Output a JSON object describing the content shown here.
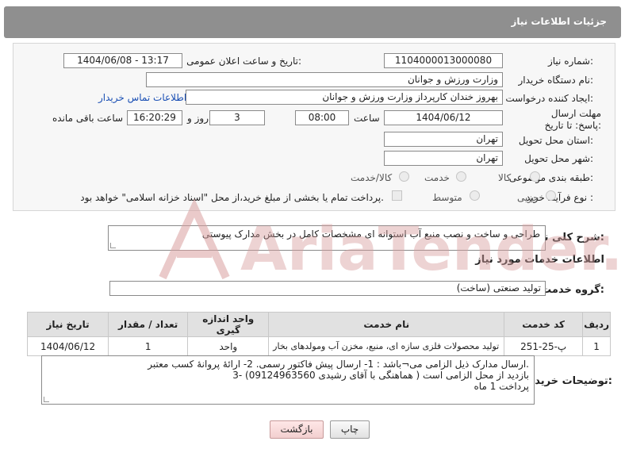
{
  "header": {
    "title": "جزئیات اطلاعات نیاز"
  },
  "form": {
    "need_number_label": "شماره نیاز:",
    "need_number": "1104000013000080",
    "announce_label": "تاریخ و ساعت اعلان عمومی:",
    "announce_value": "1404/06/08 - 13:17",
    "buyer_org_label": "نام دستگاه خریدار:",
    "buyer_org": "وزارت ورزش و جوانان",
    "creator_label": "ایجاد کننده درخواست:",
    "creator": "بهروز  خندان  کارپرداز وزارت ورزش و جوانان",
    "contact_link": "اطلاعات تماس خریدار",
    "deadline_label": "مهلت ارسال پاسخ: تا تاریخ:",
    "deadline_date": "1404/06/12",
    "time_label": "ساعت",
    "deadline_time": "08:00",
    "days_value": "3",
    "days_label": "روز و",
    "remaining_time": "16:20:29",
    "remaining_label": "ساعت باقی مانده",
    "province_label": "استان محل تحویل:",
    "province": "تهران",
    "city_label": "شهر محل تحویل:",
    "city": "تهران",
    "category_label": "طبقه بندی موضوعی:",
    "category_options": [
      "کالا",
      "خدمت",
      "کالا/خدمت"
    ],
    "process_label": "نوع فرآیند خرید :",
    "process_options": [
      "جزیی",
      "متوسط"
    ],
    "payment_note": "پرداخت تمام یا بخشی از مبلغ خرید،از محل \"اسناد خزانه اسلامی\" خواهد بود."
  },
  "summary": {
    "label": "شرح کلی نیاز:",
    "text": "طراحی و ساخت و نصب منبع آب استوانه ای مشخصات کامل در بخش مدارک پیوستی"
  },
  "services": {
    "section_title": "اطلاعات خدمات مورد نیاز",
    "group_label": "گروه خدمت:",
    "group_value": "تولید صنعتی (ساخت)",
    "columns": [
      "ردیف",
      "کد خدمت",
      "نام خدمت",
      "واحد اندازه گیری",
      "تعداد / مقدار",
      "تاریخ نیاز"
    ],
    "rows": [
      [
        "1",
        "پ-25-251",
        "تولید محصولات فلزی سازه ای، منبع، مخزن آب ومولدهای بخار",
        "واحد",
        "1",
        "1404/06/12"
      ]
    ]
  },
  "buyer_notes": {
    "label": "توضیحات خریدار:",
    "lines": [
      "ارسال مدارک ذیل الزامی می¬باشد : 1- ارسال پیش فاکتور رسمی. 2- ارائهٔ پروانهٔ کسب معتبر.",
      "3- بازدید از محل الزامی است ( هماهنگی با آقای رشیدی 09124963560)",
      "پرداخت 1 ماه"
    ]
  },
  "buttons": {
    "print": "چاپ",
    "back": "بازگشت"
  },
  "watermark": {
    "text": "AriaTender.net"
  },
  "colors": {
    "header": "#8f8f8f",
    "link": "#1a4fb4",
    "watermark": "#d9a0a0"
  }
}
